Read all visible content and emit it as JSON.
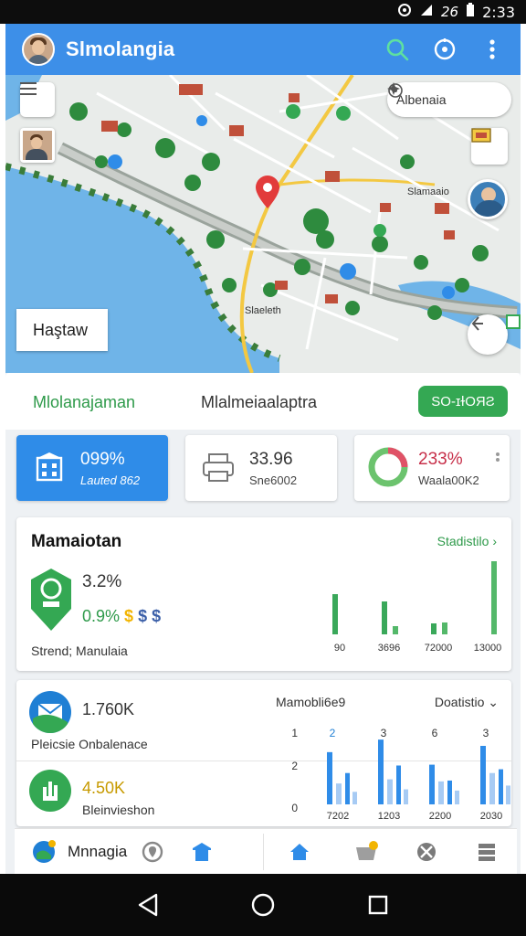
{
  "status_bar": {
    "time": "2:33",
    "signal": "26"
  },
  "app_bar": {
    "title": "Slmolangia"
  },
  "map": {
    "search_label": "Albenaia",
    "overlay_label": "Haştaw",
    "place_labels": [
      "Slamaaio",
      "Slaeleth"
    ]
  },
  "tabs": {
    "tab1": "Mlolanajaman",
    "tab2": "Mlalmeiaalaptra",
    "button": "SO-ɪɫOЯƧ"
  },
  "stats": [
    {
      "value": "099%",
      "sub": "Lauted 862",
      "color": "#2f8ce8"
    },
    {
      "value": "33.96",
      "sub": "Sne6002"
    },
    {
      "value": "233%",
      "sub": "Waala00K2",
      "value_color": "#c7304a"
    }
  ],
  "panel1": {
    "title": "Mamaiotan",
    "link": "Stadistilo",
    "value1": "3.2%",
    "value2": "0.9%",
    "currency_1": "$",
    "currency_2": "$ $",
    "caption": "Strend; Manulaia",
    "chart_data": {
      "type": "bar",
      "categories": [
        "90",
        "3696",
        "72000",
        "13000"
      ],
      "series": [
        {
          "values": [
            44,
            36,
            12,
            0
          ]
        },
        {
          "values": [
            0,
            9,
            13,
            80
          ]
        }
      ]
    }
  },
  "panel2": {
    "head": "Mamobli6e9",
    "dropdown": "Doatistio",
    "value1": "1.760K",
    "sub1": "Pleicsie Onbalenace",
    "value2": "4.50K",
    "sub2": "Bleinvieshon",
    "chart_data": {
      "type": "bar",
      "y_ticks": [
        "1",
        "2",
        "0"
      ],
      "top_labels": [
        "2",
        "3",
        "6",
        "3"
      ],
      "x_labels": [
        "7202",
        "1203",
        "2200",
        "2030"
      ],
      "series": [
        {
          "color": "#2f8ce8",
          "values": [
            50,
            62,
            38,
            56
          ]
        },
        {
          "color": "#a7cbf4",
          "values": [
            20,
            24,
            22,
            30
          ]
        }
      ]
    }
  },
  "bottom_tabs": {
    "label": "Mnnagia"
  },
  "colors": {
    "accent": "#3d8fe8",
    "green": "#34a853",
    "blue": "#2f8ce8"
  }
}
